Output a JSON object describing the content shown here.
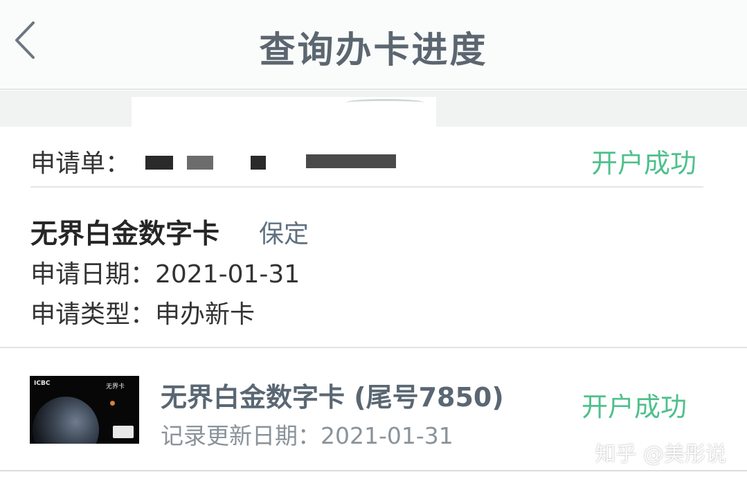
{
  "header": {
    "title": "查询办卡进度"
  },
  "application": {
    "number_label": "申请单：",
    "status": "开户成功",
    "card_name": "无界白金数字卡",
    "card_tag": "保定",
    "date_line": "申请日期：2021-01-31",
    "type_line": "申请类型：申办新卡"
  },
  "card": {
    "thumbnail_brand": "ICBC",
    "thumbnail_name": "无界卡",
    "name": "无界白金数字卡 (尾号7850)",
    "update_line": "记录更新日期：2021-01-31",
    "status": "开户成功"
  },
  "watermark": "知乎 @美彤说",
  "colors": {
    "status_green": "#4fc08c",
    "title_gray": "#5b6670",
    "card_name_slate": "#5a6773"
  },
  "icons": {
    "back": "chevron-left-icon"
  }
}
